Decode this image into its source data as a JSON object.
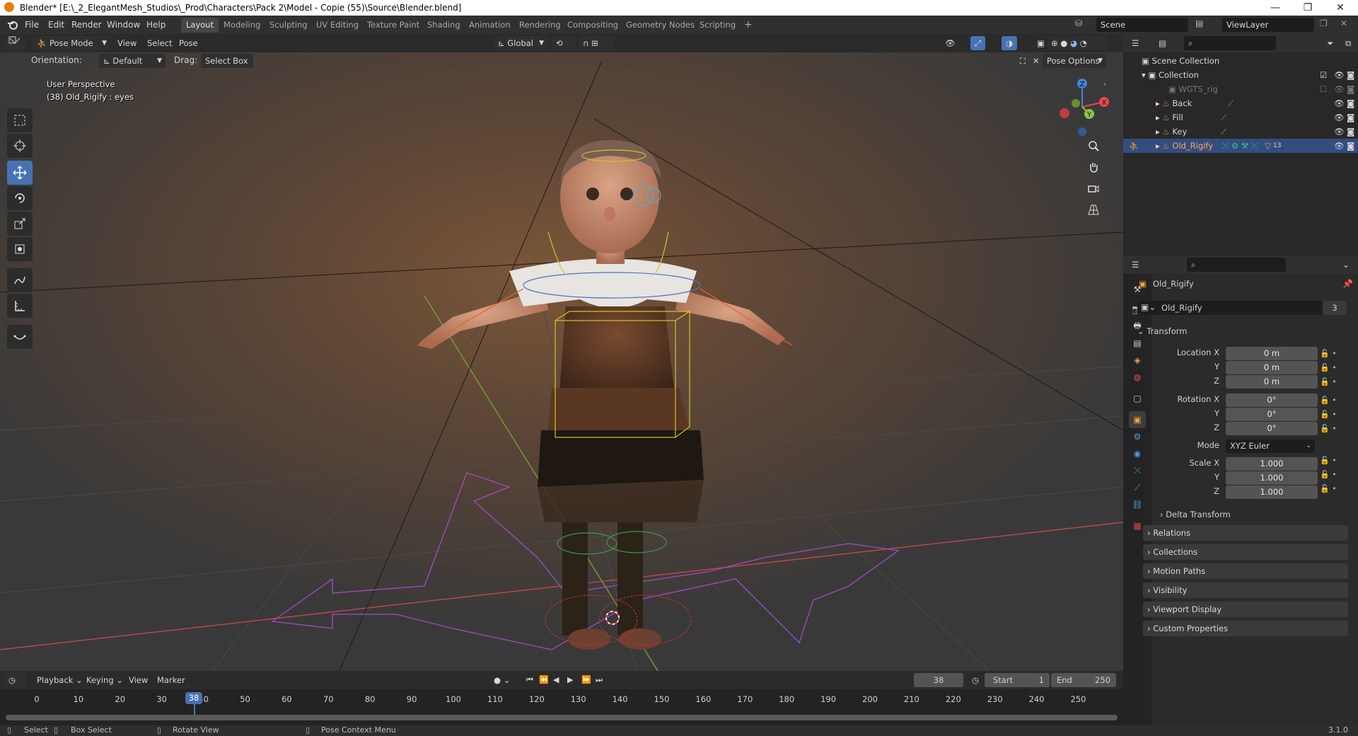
{
  "window": {
    "title": "Blender* [E:\\_2_ElegantMesh_Studios\\_Prod\\Characters\\Pack 2\\Model - Copie (55)\\Source\\Blender.blend]",
    "controls": [
      "—",
      "❐",
      "✕"
    ]
  },
  "menu": {
    "items": [
      "File",
      "Edit",
      "Render",
      "Window",
      "Help"
    ],
    "workspaces": [
      "Layout",
      "Modeling",
      "Sculpting",
      "UV Editing",
      "Texture Paint",
      "Shading",
      "Animation",
      "Rendering",
      "Compositing",
      "Geometry Nodes",
      "Scripting"
    ],
    "active_workspace": "Layout",
    "add_tab": "+",
    "scene": "Scene",
    "view_layer": "ViewLayer"
  },
  "viewport_header": {
    "mode": "Pose Mode",
    "menus": [
      "View",
      "Select",
      "Pose"
    ],
    "transform_orientation": "Global",
    "orientation_label": "Orientation:",
    "orientation_value": "Default",
    "drag_label": "Drag:",
    "drag_value": "Select Box",
    "pose_options": "Pose Options"
  },
  "viewport": {
    "view_name": "User Perspective",
    "active_info": "(38) Old_Rigify : eyes",
    "gizmo": {
      "x": "X",
      "y": "Y",
      "z": "Z"
    },
    "accent_colors": {
      "x_axis": "#e8474e",
      "y_axis": "#8bc43f",
      "z_axis": "#3f86d6",
      "selection": "#4772b3"
    }
  },
  "toolbar": {
    "tools": [
      "select-box",
      "cursor",
      "move",
      "rotate",
      "scale",
      "transform",
      "annotate",
      "measure",
      "bone-roll"
    ],
    "active_tool": "move"
  },
  "outliner": {
    "search_placeholder": "",
    "scene_collection": "Scene Collection",
    "collection": "Collection",
    "items": [
      {
        "name": "WGTS_rig",
        "dimmed": true
      },
      {
        "name": "Back",
        "dimmed": false
      },
      {
        "name": "Fill",
        "dimmed": false
      },
      {
        "name": "Key",
        "dimmed": false
      },
      {
        "name": "Old_Rigify",
        "dimmed": false,
        "selected": true
      }
    ],
    "old_rigify_modifier_count": "13"
  },
  "properties": {
    "object_name": "Old_Rigify",
    "data_name": "Old_Rigify",
    "user_count": "3",
    "transform_header": "Transform",
    "location": {
      "label": "Location X",
      "x": "0 m",
      "y": "0 m",
      "z": "0 m"
    },
    "rotation": {
      "label": "Rotation X",
      "x": "0°",
      "y": "0°",
      "z": "0°"
    },
    "mode_label": "Mode",
    "mode_value": "XYZ Euler",
    "scale": {
      "label": "Scale X",
      "x": "1.000",
      "y": "1.000",
      "z": "1.000"
    },
    "axis_labels": {
      "y": "Y",
      "z": "Z"
    },
    "sections": [
      "Delta Transform",
      "Relations",
      "Collections",
      "Motion Paths",
      "Visibility",
      "Viewport Display",
      "Custom Properties"
    ]
  },
  "timeline": {
    "menus": [
      "Playback",
      "Keying",
      "View",
      "Marker"
    ],
    "current_frame": "38",
    "start_label": "Start",
    "start": "1",
    "end_label": "End",
    "end": "250",
    "ticks": [
      "0",
      "10",
      "20",
      "30",
      "40",
      "50",
      "60",
      "70",
      "80",
      "90",
      "100",
      "110",
      "120",
      "130",
      "140",
      "150",
      "160",
      "170",
      "180",
      "190",
      "200",
      "210",
      "220",
      "230",
      "240",
      "250"
    ]
  },
  "statusbar": {
    "select": "Select",
    "box_select": "Box Select",
    "rotate_view": "Rotate View",
    "context_menu": "Pose Context Menu",
    "version": "3.1.0"
  }
}
